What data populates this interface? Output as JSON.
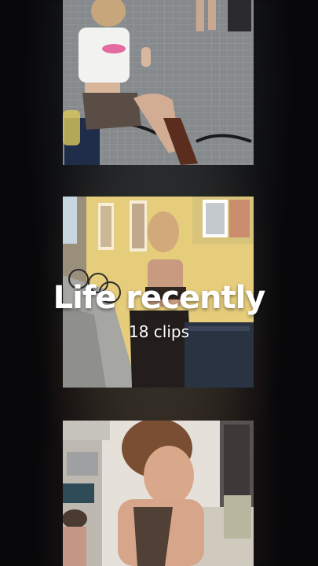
{
  "video": {
    "title": "Life recently",
    "subtitle": "18 clips"
  },
  "clips": [
    {
      "name": "clip-1",
      "accent": "#8a8d8f"
    },
    {
      "name": "clip-2",
      "accent": "#e9d27e"
    },
    {
      "name": "clip-3",
      "accent": "#e7e3dc"
    }
  ]
}
